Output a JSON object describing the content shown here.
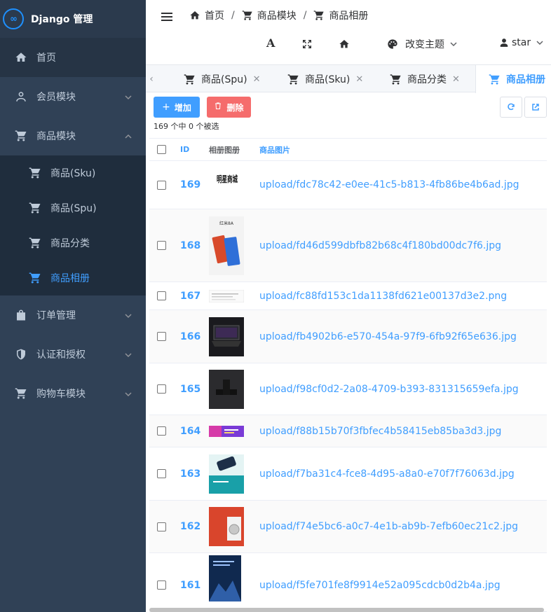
{
  "brand": {
    "logo_text": "∞",
    "title": "Django 管理"
  },
  "sidebar": {
    "items": [
      {
        "label": "首页",
        "icon": "home-icon"
      },
      {
        "label": "会员模块",
        "icon": "user-icon"
      },
      {
        "label": "商品模块",
        "icon": "cart-icon"
      },
      {
        "label": "订单管理",
        "icon": "bag-icon"
      },
      {
        "label": "认证和授权",
        "icon": "shield-icon"
      },
      {
        "label": "购物车模块",
        "icon": "cart-icon"
      }
    ],
    "submenu": [
      {
        "label": "商品(Sku)"
      },
      {
        "label": "商品(Spu)"
      },
      {
        "label": "商品分类"
      },
      {
        "label": "商品相册"
      }
    ]
  },
  "header": {
    "breadcrumb": [
      "首页",
      "商品模块",
      "商品相册"
    ],
    "separator": "/",
    "font_icon_label": "A",
    "theme_label": "改变主题",
    "user_label": "star"
  },
  "tabs": [
    {
      "label": "商品(Spu)"
    },
    {
      "label": "商品(Sku)"
    },
    {
      "label": "商品分类"
    },
    {
      "label": "商品相册"
    }
  ],
  "toolbar": {
    "add_label": "增加",
    "add_icon": "+",
    "delete_label": "删除",
    "selection_text": "169 个中 0 个被选"
  },
  "table": {
    "headers": {
      "id": "ID",
      "image": "相册图册",
      "url": "商品图片"
    },
    "rows": [
      {
        "id": "169",
        "url": "upload/fdc78c42-e0ee-41c5-b813-4fb86be4b6ad.jpg",
        "thumb_text": "明星商城"
      },
      {
        "id": "168",
        "url": "upload/fd46d599dbfb82b68c4f180bd00dc7f6.jpg",
        "thumb_text": "红米8A"
      },
      {
        "id": "167",
        "url": "upload/fc88fd153c1da1138fd621e00137d3e2.png",
        "thumb_text": ""
      },
      {
        "id": "166",
        "url": "upload/fb4902b6-e570-454a-97f9-6fb92f65e636.jpg",
        "thumb_text": ""
      },
      {
        "id": "165",
        "url": "upload/f98cf0d2-2a08-4709-b393-831315659efa.jpg",
        "thumb_text": ""
      },
      {
        "id": "164",
        "url": "upload/f88b15b70f3fbfec4b58415eb85ba3d3.jpg",
        "thumb_text": ""
      },
      {
        "id": "163",
        "url": "upload/f7ba31c4-fce8-4d95-a8a0-e70f7f76063d.jpg",
        "thumb_text": ""
      },
      {
        "id": "162",
        "url": "upload/f74e5bc6-a0c7-4e1b-ab9b-7efb60ec21c2.jpg",
        "thumb_text": ""
      },
      {
        "id": "161",
        "url": "upload/f5fe701fe8f9914e52a095cdcb0d2b4a.jpg",
        "thumb_text": ""
      }
    ]
  },
  "colors": {
    "sidebar_bg": "#304156",
    "accent": "#409eff",
    "danger": "#f56c6c"
  }
}
